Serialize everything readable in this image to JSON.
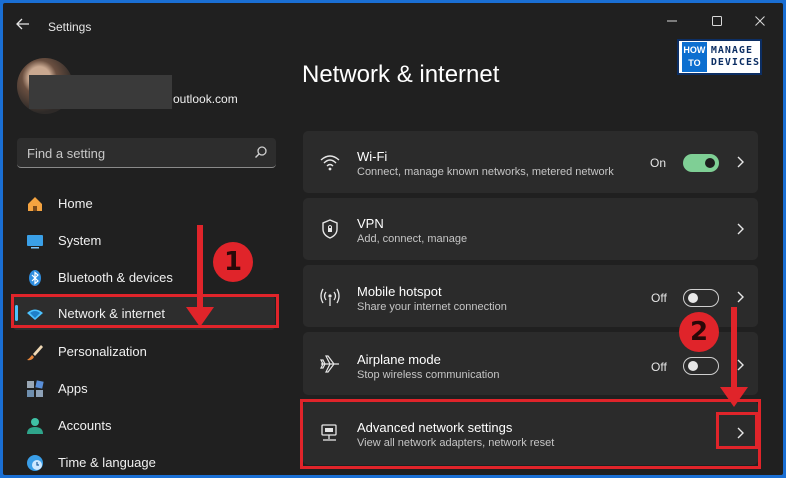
{
  "window": {
    "title": "Settings",
    "back_icon": "back-arrow-icon",
    "controls": [
      "minimize-icon",
      "maximize-icon",
      "close-icon"
    ]
  },
  "logo": {
    "how": "HOW",
    "to": "TO",
    "line1": "MANAGE",
    "line2": "DEVICES"
  },
  "profile": {
    "email_suffix": "outlook.com"
  },
  "search": {
    "placeholder": "Find a setting",
    "value": ""
  },
  "sidebar": {
    "items": [
      {
        "label": "Home",
        "icon": "home-icon",
        "active": false
      },
      {
        "label": "System",
        "icon": "system-icon",
        "active": false
      },
      {
        "label": "Bluetooth & devices",
        "icon": "bluetooth-icon",
        "active": false
      },
      {
        "label": "Network & internet",
        "icon": "network-icon",
        "active": true
      },
      {
        "label": "Personalization",
        "icon": "brush-icon",
        "active": false
      },
      {
        "label": "Apps",
        "icon": "apps-icon",
        "active": false
      },
      {
        "label": "Accounts",
        "icon": "accounts-icon",
        "active": false
      },
      {
        "label": "Time & language",
        "icon": "time-language-icon",
        "active": false
      }
    ]
  },
  "main": {
    "title": "Network & internet",
    "cards": [
      {
        "title": "Wi-Fi",
        "subtitle": "Connect, manage known networks, metered network",
        "state": "On",
        "toggle_on": true,
        "icon": "wifi-icon"
      },
      {
        "title": "VPN",
        "subtitle": "Add, connect, manage",
        "icon": "vpn-shield-icon"
      },
      {
        "title": "Mobile hotspot",
        "subtitle": "Share your internet connection",
        "state": "Off",
        "toggle_on": false,
        "icon": "hotspot-icon"
      },
      {
        "title": "Airplane mode",
        "subtitle": "Stop wireless communication",
        "state": "Off",
        "toggle_on": false,
        "icon": "airplane-icon"
      },
      {
        "title": "Advanced network settings",
        "subtitle": "View all network adapters, network reset",
        "icon": "advanced-network-icon"
      }
    ]
  },
  "annotations": {
    "step1": "1",
    "step2": "2"
  },
  "colors": {
    "accent": "#4cc2ff",
    "highlight_red": "#e0242a",
    "toggle_on": "#7fcf95",
    "background": "#202020",
    "card": "#2b2b2b"
  }
}
